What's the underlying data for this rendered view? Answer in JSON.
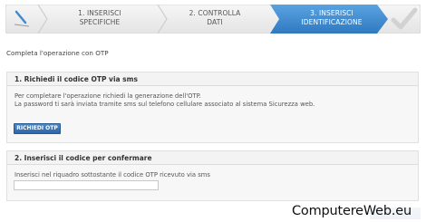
{
  "stepper": {
    "steps": [
      {
        "line1": "1. INSERISCI",
        "line2": "SPECIFICHE",
        "state": "done"
      },
      {
        "line1": "2. CONTROLLA",
        "line2": "DATI",
        "state": "done"
      },
      {
        "line1": "3. INSERISCI",
        "line2": "IDENTIFICAZIONE",
        "state": "active"
      }
    ],
    "colors": {
      "inactive": "#eeeeee",
      "active": "#3e8bd0",
      "check": "#d8d8d8"
    }
  },
  "intro_text": "Completa l'operazione con OTP",
  "section1": {
    "title": "1. Richiedi il codice OTP via sms",
    "line1": "Per completare l'operazione richiedi la generazione dell'OTP.",
    "line2": "La password ti sarà inviata tramite sms sul telefono cellulare associato al sistema Sicurezza web.",
    "button_label": "RICHIEDI OTP"
  },
  "section2": {
    "title": "2. Inserisci il codice per confermare",
    "line1": "Inserisci nel riquadro sottostante il codice OTP ricevuto via sms",
    "input_value": ""
  },
  "watermark": "ComputereWeb.eu"
}
